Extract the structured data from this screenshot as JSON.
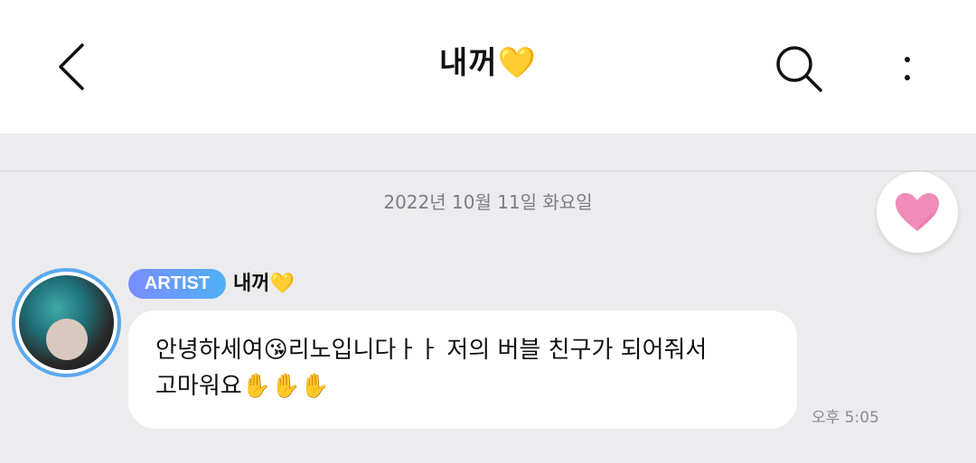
{
  "header": {
    "title": "내꺼💛",
    "back_icon": "chevron-left-icon",
    "search_icon": "search-icon",
    "more_icon": "more-vertical-icon"
  },
  "date_separator": "2022년 10월 11일 화요일",
  "reaction_button": {
    "icon": "heart-icon",
    "color": "#f08cb8"
  },
  "message": {
    "badge": "ARTIST",
    "sender": "내꺼💛",
    "text_line1": "안녕하세여😘리노입니다ㅏㅏ 저의 버블 친구가 되어줘서",
    "text_line2": "고마워요✋✋✋",
    "time": "오후 5:05"
  },
  "colors": {
    "accent_blue": "#5aa9ef",
    "badge_gradient_start": "#7b8cff",
    "badge_gradient_end": "#4fb0f5",
    "background": "#ececee"
  }
}
